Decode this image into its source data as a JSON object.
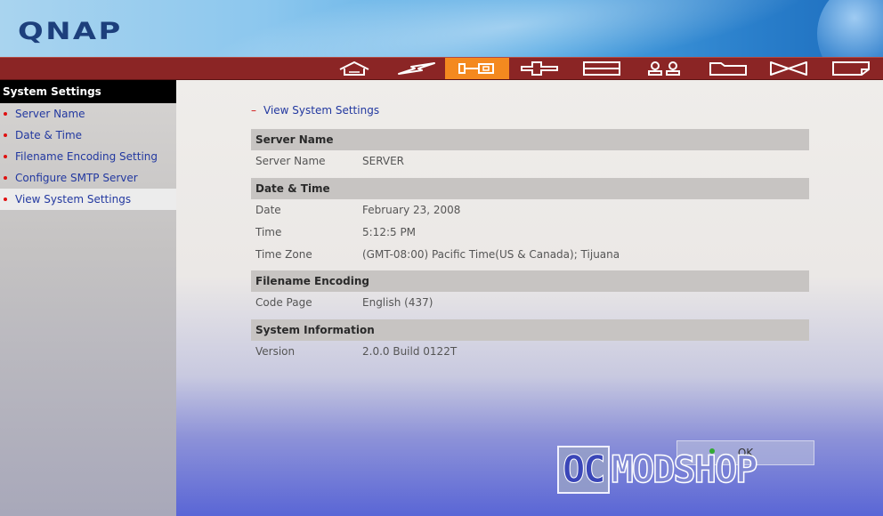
{
  "header": {
    "logo_text": "QNAP"
  },
  "nav": {
    "items": [
      {
        "icon": "home-icon",
        "active": false
      },
      {
        "icon": "bolt-icon",
        "active": false
      },
      {
        "icon": "system-tools-icon",
        "active": true
      },
      {
        "icon": "network-icon",
        "active": false
      },
      {
        "icon": "disk-icon",
        "active": false
      },
      {
        "icon": "users-icon",
        "active": false
      },
      {
        "icon": "folder-icon",
        "active": false
      },
      {
        "icon": "hourglass-icon",
        "active": false
      },
      {
        "icon": "note-icon",
        "active": false
      }
    ],
    "accent_color": "#f4891f",
    "bar_color": "#8b2525"
  },
  "sidebar": {
    "title": "System Settings",
    "items": [
      {
        "label": "Server Name"
      },
      {
        "label": "Date & Time"
      },
      {
        "label": "Filename Encoding Setting"
      },
      {
        "label": "Configure SMTP Server"
      },
      {
        "label": "View System Settings"
      }
    ]
  },
  "main": {
    "breadcrumb": "View System Settings",
    "sections": [
      {
        "title": "Server Name",
        "rows": [
          {
            "key": "Server Name",
            "value": "SERVER"
          }
        ]
      },
      {
        "title": "Date & Time",
        "rows": [
          {
            "key": "Date",
            "value": "February 23, 2008"
          },
          {
            "key": "Time",
            "value": "5:12:5 PM"
          },
          {
            "key": "Time Zone",
            "value": "(GMT-08:00) Pacific Time(US & Canada); Tijuana"
          }
        ]
      },
      {
        "title": "Filename Encoding",
        "rows": [
          {
            "key": "Code Page",
            "value": "English (437)"
          }
        ]
      },
      {
        "title": "System Information",
        "rows": [
          {
            "key": "Version",
            "value": "2.0.0 Build 0122T"
          }
        ]
      }
    ]
  },
  "watermark": {
    "box_text": "OC",
    "text": "MODSHOP",
    "button_fragment": "OK"
  }
}
